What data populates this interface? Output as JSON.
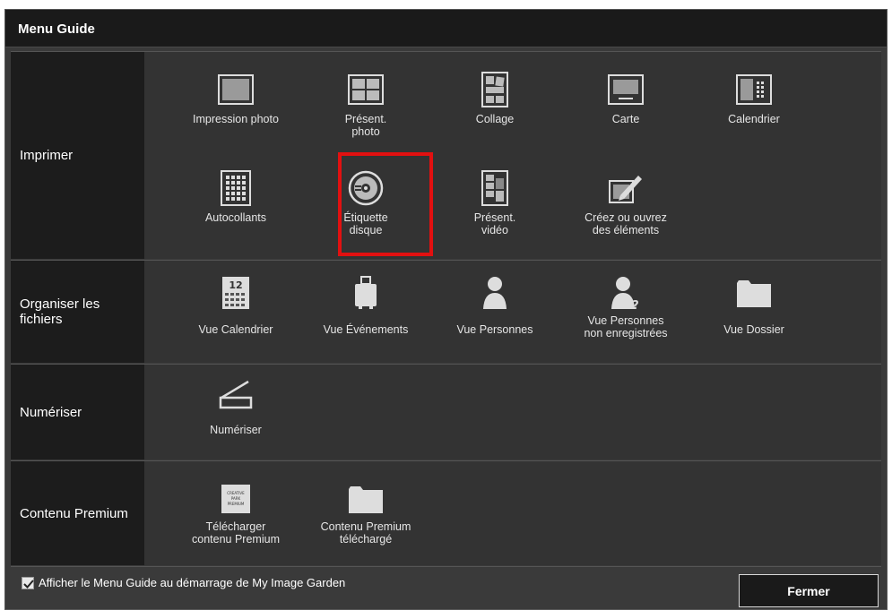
{
  "window": {
    "title": "Menu Guide"
  },
  "sections": {
    "print": {
      "label": "Imprimer",
      "items": [
        {
          "label": "Impression photo",
          "icon": "photo-print-icon"
        },
        {
          "label": "Présent.\nphoto",
          "icon": "photo-layout-icon"
        },
        {
          "label": "Collage",
          "icon": "collage-icon"
        },
        {
          "label": "Carte",
          "icon": "card-icon"
        },
        {
          "label": "Calendrier",
          "icon": "calendar-print-icon"
        },
        {
          "label": "Autocollants",
          "icon": "stickers-icon"
        },
        {
          "label": "Étiquette\ndisque",
          "icon": "disc-label-icon",
          "selected": true
        },
        {
          "label": "Présent.\nvidéo",
          "icon": "video-layout-icon"
        },
        {
          "label": "Créez ou ouvrez\ndes éléments",
          "icon": "create-open-items-icon"
        }
      ]
    },
    "organize": {
      "label": "Organiser les fichiers",
      "items": [
        {
          "label": "Vue Calendrier",
          "icon": "calendar-view-icon"
        },
        {
          "label": "Vue Événements",
          "icon": "event-view-icon"
        },
        {
          "label": "Vue Personnes",
          "icon": "people-view-icon"
        },
        {
          "label": "Vue Personnes\nnon enregistrées",
          "icon": "unregistered-people-icon"
        },
        {
          "label": "Vue Dossier",
          "icon": "folder-view-icon"
        }
      ]
    },
    "scan": {
      "label": "Numériser",
      "items": [
        {
          "label": "Numériser",
          "icon": "scanner-icon"
        }
      ]
    },
    "premium": {
      "label": "Contenu Premium",
      "items": [
        {
          "label": "Télécharger\ncontenu Premium",
          "icon": "creative-park-icon",
          "icon_text": "CREATIVE PARK PREMIUM"
        },
        {
          "label": "Contenu Premium\ntéléchargé",
          "icon": "premium-folder-icon"
        }
      ]
    }
  },
  "footer": {
    "startup_checkbox_label": "Afficher le Menu Guide au démarrage de My Image Garden",
    "startup_checkbox_checked": true,
    "close_label": "Fermer"
  },
  "colors": {
    "highlight": "#e21010",
    "panel": "#333333",
    "label_column": "#1c1c1c",
    "titlebar": "#1a1a1a"
  }
}
